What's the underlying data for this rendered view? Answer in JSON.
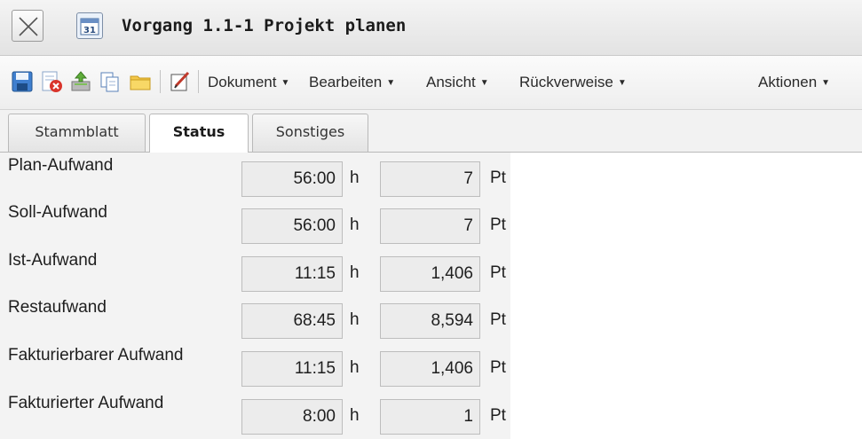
{
  "window": {
    "title": "Vorgang 1.1-1 Projekt planen",
    "close_icon": "close-x-icon",
    "title_icon": "task-calendar-icon"
  },
  "toolbar": {
    "icons": [
      "save-icon",
      "delete-icon",
      "export-icon",
      "copy-icon",
      "folder-icon",
      "edit-icon"
    ],
    "menus": [
      {
        "label": "Dokument"
      },
      {
        "label": "Bearbeiten"
      },
      {
        "label": "Ansicht"
      },
      {
        "label": "Rückverweise"
      },
      {
        "label": "Aktionen"
      }
    ]
  },
  "tabs": [
    {
      "label": "Stammblatt",
      "active": false
    },
    {
      "label": "Status",
      "active": true
    },
    {
      "label": "Sonstiges",
      "active": false
    }
  ],
  "rows": [
    {
      "label": "Plan-Aufwand",
      "hours": "56:00",
      "hours_unit": "h",
      "days": "7",
      "days_unit": "Pt"
    },
    {
      "label": "Soll-Aufwand",
      "hours": "56:00",
      "hours_unit": "h",
      "days": "7",
      "days_unit": "Pt"
    },
    {
      "label": "Ist-Aufwand",
      "hours": "11:15",
      "hours_unit": "h",
      "days": "1,406",
      "days_unit": "Pt"
    },
    {
      "label": "Restaufwand",
      "hours": "68:45",
      "hours_unit": "h",
      "days": "8,594",
      "days_unit": "Pt"
    },
    {
      "label": "Fakturierbarer Aufwand",
      "hours": "11:15",
      "hours_unit": "h",
      "days": "1,406",
      "days_unit": "Pt"
    },
    {
      "label": "Fakturierter Aufwand",
      "hours": "8:00",
      "hours_unit": "h",
      "days": "1",
      "days_unit": "Pt"
    }
  ]
}
